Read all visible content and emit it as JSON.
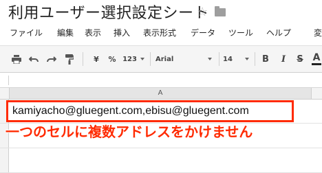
{
  "doc": {
    "title": "利用ユーザー選択設定シート"
  },
  "menu": {
    "items": [
      "ファイル",
      "編集",
      "表示",
      "挿入",
      "表示形式",
      "データ",
      "ツール",
      "ヘルプ",
      "変"
    ]
  },
  "toolbar": {
    "currency": "¥",
    "percent": "%",
    "number_format": "123",
    "font": "Arial",
    "font_size": "14",
    "bold": "B",
    "italic": "I",
    "strike": "S",
    "text_color": "A"
  },
  "sheet": {
    "column_a_header": "A",
    "cell_a1": "kamiyacho@gluegent.com,ebisu@gluegent.com"
  },
  "annotation": {
    "text": "一つのセルに複数アドレスをかけません"
  },
  "colors": {
    "highlight": "#ff2a00",
    "toolbar_bg": "#f5f5f5"
  }
}
